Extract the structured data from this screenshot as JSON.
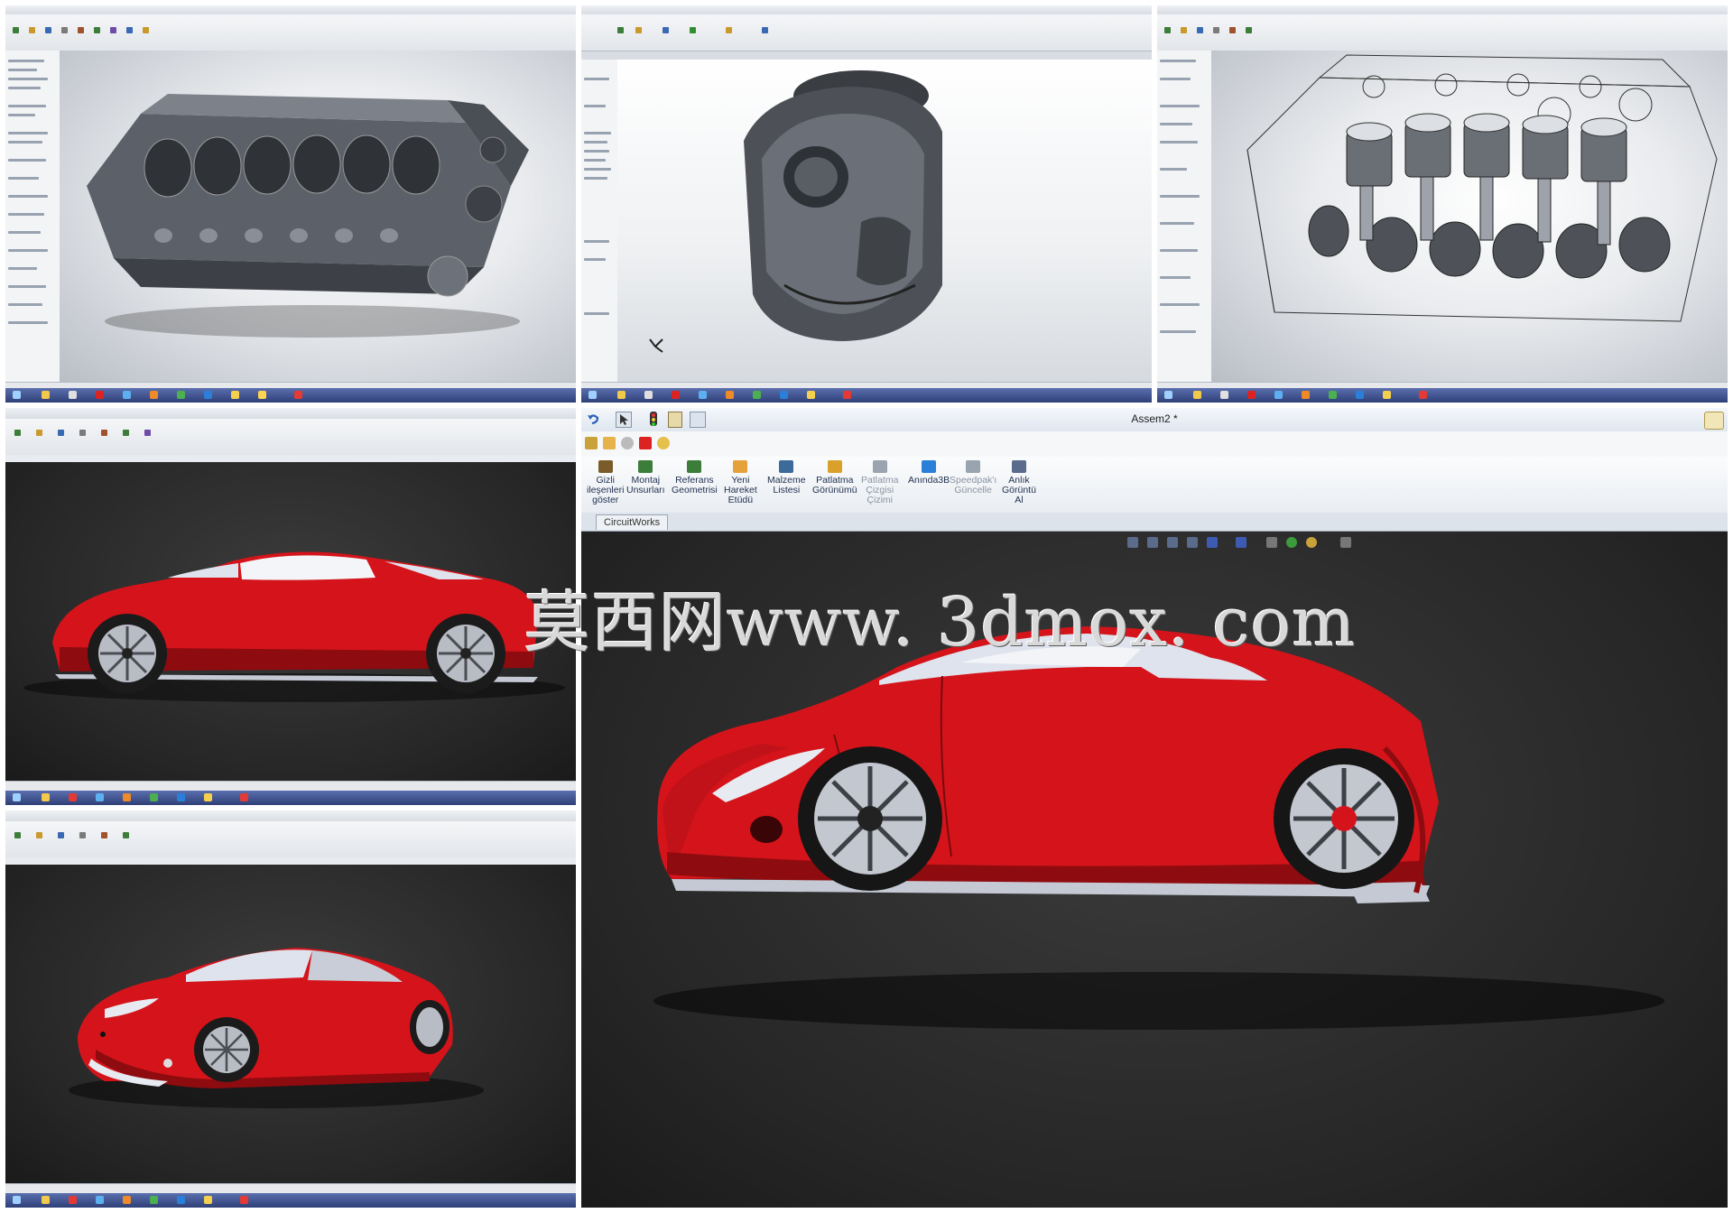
{
  "watermark": "莫西网www. 3dmox. com",
  "panel_bottom_right": {
    "title": "Assem2 *",
    "ribbon": [
      {
        "label": "Gizli\nileşenleri\ngöster",
        "dim": false
      },
      {
        "label": "Montaj\nUnsurları",
        "dim": false
      },
      {
        "label": "Referans\nGeometrisi",
        "dim": false
      },
      {
        "label": "Yeni\nHareket\nEtüdü",
        "dim": false
      },
      {
        "label": "Malzeme\nListesi",
        "dim": false
      },
      {
        "label": "Patlatma\nGörünümü",
        "dim": false
      },
      {
        "label": "Patlatma\nÇizgisi\nÇizimi",
        "dim": true
      },
      {
        "label": "Anında3B",
        "dim": false
      },
      {
        "label": "Speedpak'ı\nGüncelle",
        "dim": true
      },
      {
        "label": "Anlık\nGörüntü\nAl",
        "dim": false
      }
    ],
    "tab": "CircuitWorks"
  },
  "colors": {
    "car_red": "#d4141a",
    "car_red_dark": "#8e0b0f",
    "glass": "#dfe3ee",
    "metal": "#6c7079",
    "metal_dark": "#454950",
    "taskbar": "#3b4c8a"
  },
  "icons": [
    "undo-icon",
    "pointer-icon",
    "traffic-light-icon",
    "clipboard-icon",
    "options-icon",
    "zoom-icon",
    "rotate-icon",
    "view-orientation-icon",
    "display-style-icon",
    "appearance-icon"
  ]
}
